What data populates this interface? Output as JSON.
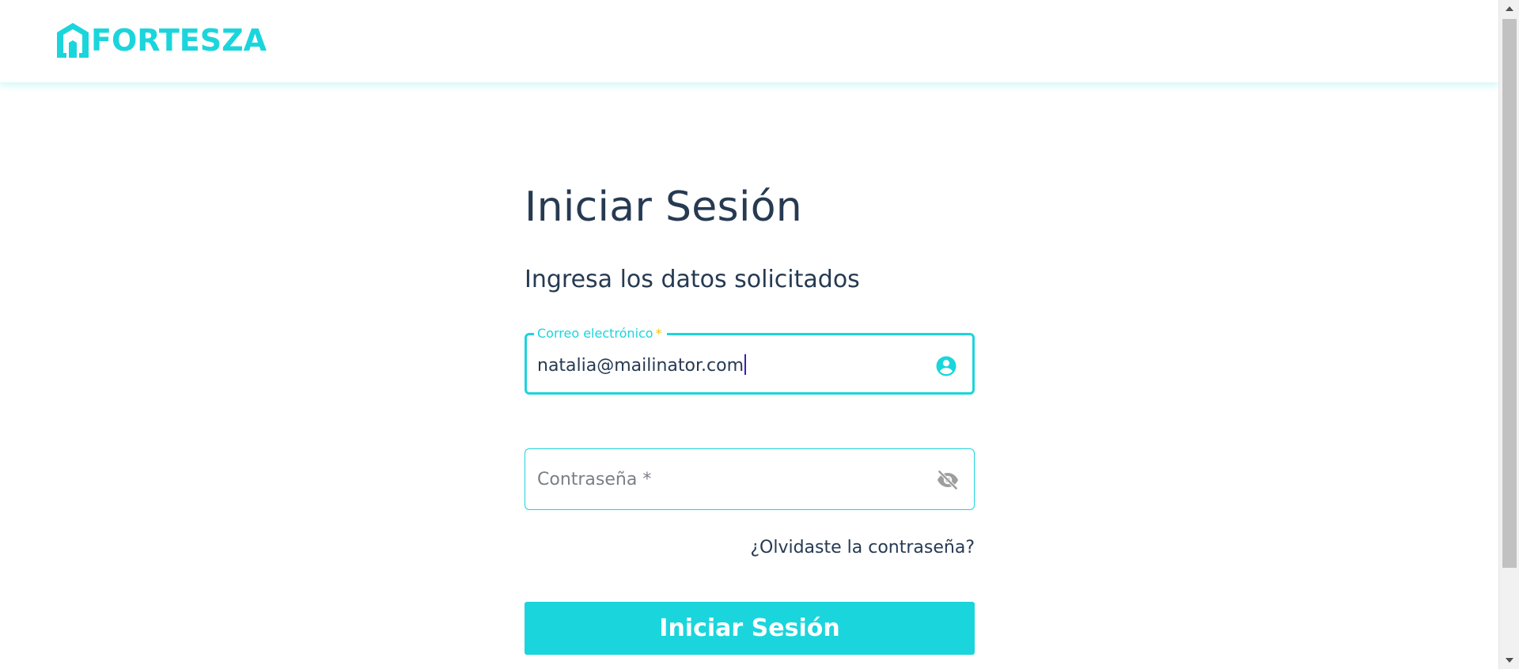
{
  "header": {
    "logo_text": "FORTESZA",
    "logo_icon": "house-logo-icon"
  },
  "login": {
    "title": "Iniciar Sesión",
    "subtitle": "Ingresa los datos solicitados",
    "email": {
      "label": "Correo electrónico",
      "required_mark": "*",
      "value": "natalia@mailinator.com",
      "icon": "account-circle-icon"
    },
    "password": {
      "placeholder": "Contraseña *",
      "value": "",
      "icon": "eye-off-icon"
    },
    "forgot_link": "¿Olvidaste la contraseña?",
    "submit_label": "Iniciar Sesión"
  },
  "colors": {
    "accent": "#1bd5dc",
    "text": "#263a52",
    "required": "#f5c518",
    "icon_muted": "#9e9e9e"
  }
}
